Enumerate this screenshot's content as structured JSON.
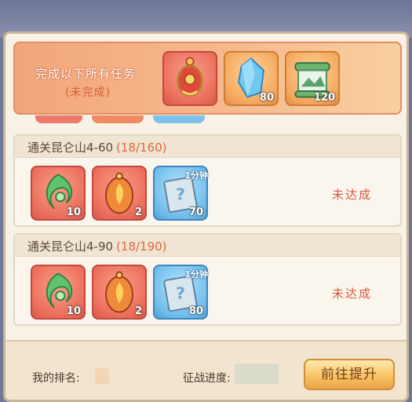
{
  "summary": {
    "title": "完成以下所有任务",
    "status": "(未完成)",
    "rewards": [
      {
        "icon": "red-medallion-icon",
        "qty": ""
      },
      {
        "icon": "blue-crystal-icon",
        "qty": "80"
      },
      {
        "icon": "scroll-chest-icon",
        "qty": "120"
      }
    ]
  },
  "tasks": [
    {
      "name": "通关昆仑山4-60",
      "progress": "(18/160)",
      "status": "未达成",
      "rewards": [
        {
          "icon": "green-jade-icon",
          "qty": "10"
        },
        {
          "icon": "fire-charm-icon",
          "qty": "2"
        },
        {
          "icon": "time-card-icon",
          "qty": "70",
          "tag": "1分钟"
        }
      ]
    },
    {
      "name": "通关昆仑山4-90",
      "progress": "(18/190)",
      "status": "未达成",
      "rewards": [
        {
          "icon": "green-jade-icon",
          "qty": "10"
        },
        {
          "icon": "fire-charm-icon",
          "qty": "2"
        },
        {
          "icon": "time-card-icon",
          "qty": "80",
          "tag": "1分钟"
        }
      ]
    }
  ],
  "footer": {
    "rank_label": "我的排名:",
    "progress_label": "征战进度:",
    "go_button": "前往提升"
  }
}
